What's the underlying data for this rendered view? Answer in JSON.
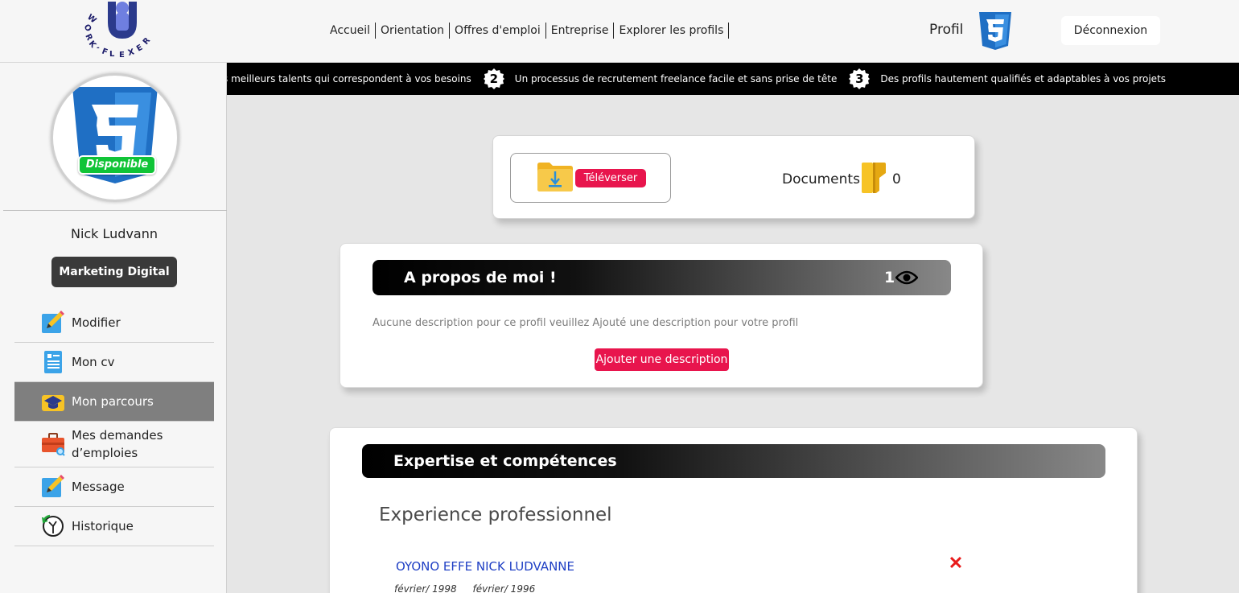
{
  "header": {
    "logo_text": "WORK·FLEXER",
    "nav": [
      "Accueil",
      "Orientation",
      "Offres d'emploi",
      "Entreprise",
      "Explorer les profils"
    ],
    "profile_label": "Profil",
    "logout_label": "Déconnexion"
  },
  "ticker": {
    "items": [
      {
        "num": "",
        "text": "s meilleurs talents qui correspondent à vos besoins"
      },
      {
        "num": "2",
        "text": "Un processus de recrutement freelance facile et sans prise de tête"
      },
      {
        "num": "3",
        "text": "Des profils hautement qualifiés et adaptables à vos projets"
      }
    ]
  },
  "sidebar": {
    "status_badge": "Disponible",
    "user_name": "Nick Ludvann",
    "specialty": "Marketing Digital",
    "menu": [
      {
        "label": "Modifier",
        "icon": "edit-icon"
      },
      {
        "label": "Mon cv",
        "icon": "cv-icon"
      },
      {
        "label": "Mon parcours",
        "icon": "graduation-icon",
        "active": true
      },
      {
        "label": "Mes demandes d’emploies",
        "icon": "briefcase-search-icon"
      },
      {
        "label": "Message",
        "icon": "message-edit-icon"
      },
      {
        "label": "Historique",
        "icon": "history-clock-icon"
      }
    ]
  },
  "documents": {
    "upload_label": "Téléverser",
    "docs_label": "Documents",
    "docs_count": "0"
  },
  "about": {
    "title": "A propos de moi !",
    "views": "1",
    "description": "Aucune description pour ce profil veuillez Ajouté une description pour votre profil",
    "add_button": "Ajouter une description"
  },
  "expertise": {
    "title": "Expertise et compétences",
    "section_title": "Experience professionnel",
    "entries": [
      {
        "name": "OYONO EFFE NICK LUDVANNE",
        "date_start": "février/ 1998",
        "date_end": "février/ 1996"
      }
    ]
  },
  "colors": {
    "accent": "#e8154d",
    "status_green": "#10c437",
    "link_blue": "#1f3fc4",
    "active_menu": "#7f7f7f"
  }
}
